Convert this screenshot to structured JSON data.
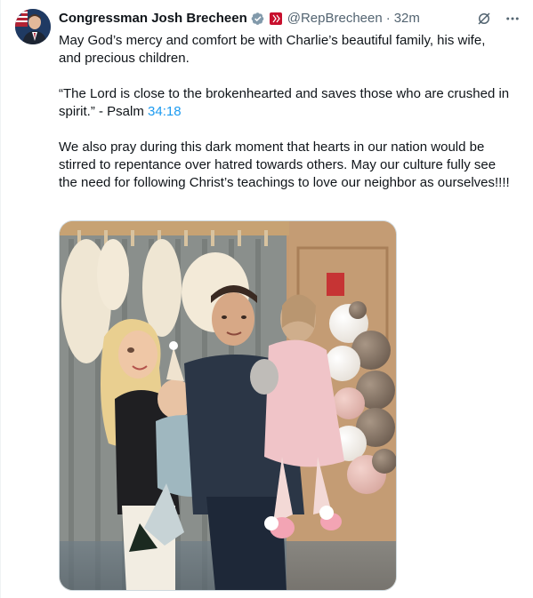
{
  "author": {
    "display_name": "Congressman Josh Brecheen",
    "handle": "@RepBrecheen",
    "separator": "·",
    "time": "32m"
  },
  "icons": {
    "verified": "verified-badge-icon",
    "affiliation": "flag-badge-icon",
    "grok": "grok-icon",
    "more": "more-icon"
  },
  "colors": {
    "link": "#1d9bf0",
    "text": "#0f1419",
    "secondary": "#536471",
    "verified": "#829aab"
  },
  "tweet": {
    "p1": "May God’s mercy and comfort be with Charlie’s beautiful family, his wife, and precious children.",
    "p2_before": "“The Lord is close to the brokenhearted and saves those who are crushed in spirit.” - Psalm ",
    "p2_link": "34:18",
    "p3": "We also pray during this dark moment that hearts in our nation would be stirred to repentance over hatred towards others. May our culture fully see the need for following Christ’s teachings to love our neighbor as ourselves!!!!"
  }
}
